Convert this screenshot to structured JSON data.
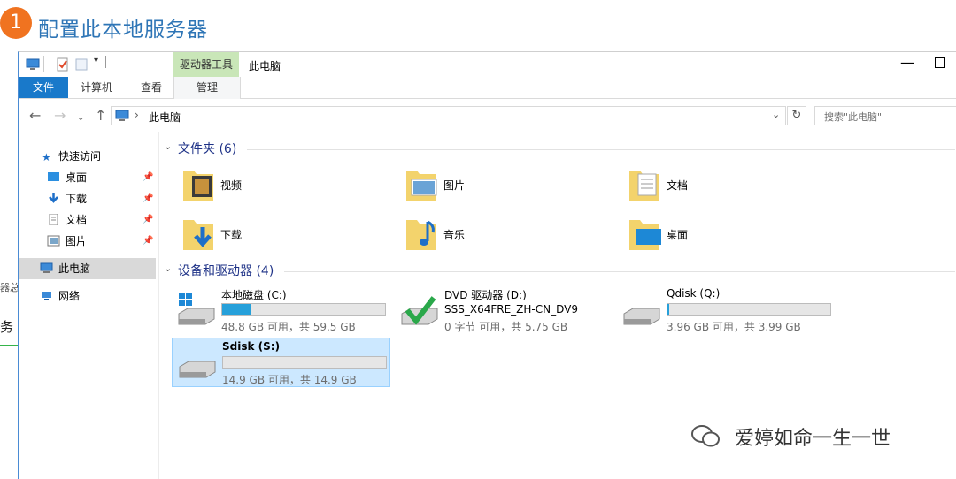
{
  "step": {
    "number": "1",
    "title": "配置此本地服务器"
  },
  "background_window": {
    "fragment_label": "器总",
    "fragment_text": "务"
  },
  "window": {
    "context_tab": "驱动器工具",
    "title": "此电脑",
    "ribbon_tabs": [
      "文件",
      "计算机",
      "查看",
      "管理"
    ],
    "address": "此电脑",
    "search_placeholder": "搜索\"此电脑\""
  },
  "nav": {
    "quick_access": "快速访问",
    "items": [
      "桌面",
      "下载",
      "文档",
      "图片"
    ],
    "this_pc": "此电脑",
    "network": "网络"
  },
  "folders_section": {
    "title": "文件夹 (6)",
    "items": [
      "视频",
      "图片",
      "文档",
      "下载",
      "音乐",
      "桌面"
    ]
  },
  "drives_section": {
    "title": "设备和驱动器 (4)",
    "drives": [
      {
        "name": "本地磁盘 (C:)",
        "info": "48.8 GB 可用，共 59.5 GB",
        "used_fraction": 0.18
      },
      {
        "name": "DVD 驱动器 (D:)",
        "label": "SSS_X64FRE_ZH-CN_DV9",
        "info": "0 字节 可用，共 5.75 GB"
      },
      {
        "name": "Qdisk (Q:)",
        "info": "3.96 GB 可用，共 3.99 GB",
        "used_fraction": 0.01
      },
      {
        "name": "Sdisk (S:)",
        "info": "14.9 GB 可用，共 14.9 GB",
        "used_fraction": 0.0
      }
    ]
  },
  "watermark": "爱婷如命一生一世",
  "colors": {
    "accent": "#1979ca",
    "step_badge": "#f07320",
    "heading": "#2e75b6",
    "progress": "#26a0da",
    "selection": "#cce8ff"
  }
}
